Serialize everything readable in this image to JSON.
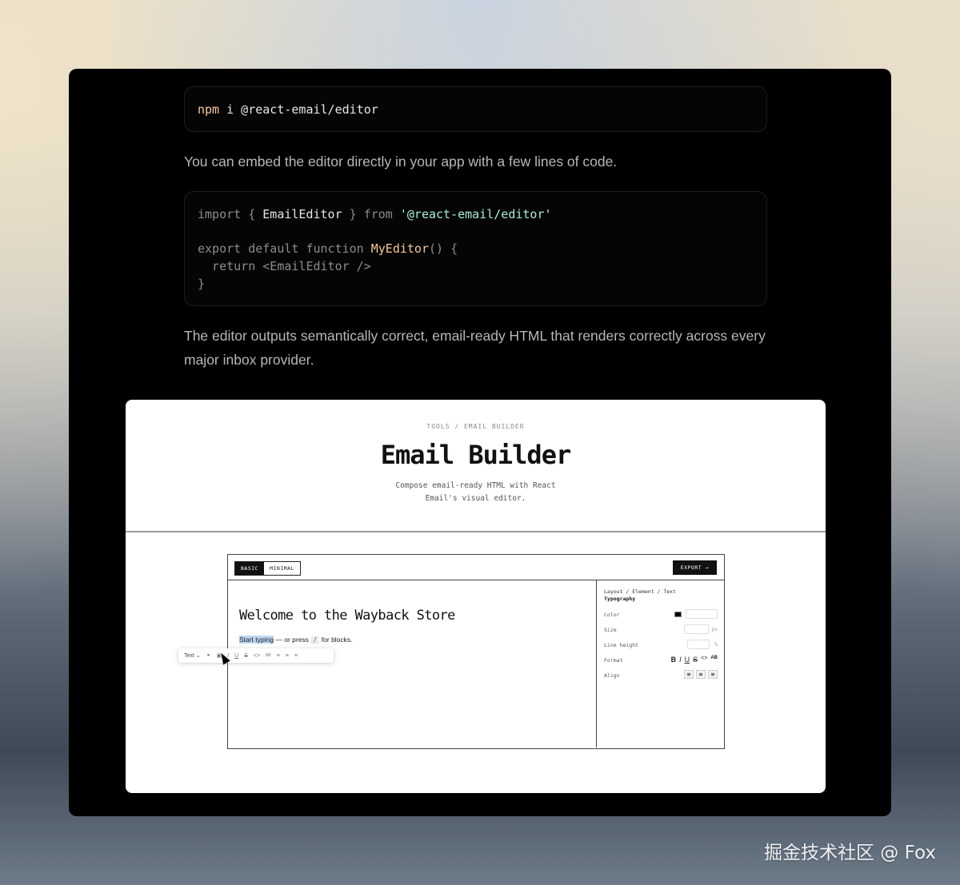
{
  "install_cmd": {
    "cmd": "npm",
    "rest": " i @react-email/editor"
  },
  "intro_text": "You can embed the editor directly in your app with a few lines of code.",
  "code": {
    "l1_import": "import",
    "l1_open": " { ",
    "l1_name": "EmailEditor",
    "l1_close": " } ",
    "l1_from": "from",
    "l1_sp": " ",
    "l1_str": "'@react-email/editor'",
    "l3_kw": "export default function ",
    "l3_fn": "MyEditor",
    "l3_tail": "() {",
    "l4": "  return <EmailEditor />",
    "l5": "}"
  },
  "outro_text": "The editor outputs semantically correct, email-ready HTML that renders correctly across every major inbox provider.",
  "shot": {
    "crumb": "TOOLS / EMAIL BUILDER",
    "title": "Email Builder",
    "subtitle_1": "Compose email-ready HTML with React",
    "subtitle_2": "Email's visual editor.",
    "tab_basic": "BASIC",
    "tab_minimal": "MINIMAL",
    "export": "EXPORT →",
    "heading": "Welcome to the Wayback Store",
    "typing_hl": "Start typing",
    "typing_mid": " — or press ",
    "typing_key": "/",
    "typing_end": " for blocks.",
    "toolbar_text": "Text ⌄",
    "panel": {
      "crumb": "Layout / Element / Text",
      "head": "Typography",
      "color": "Color",
      "size": "Size",
      "size_unit": "px",
      "line_height": "Line height",
      "lh_unit": "%",
      "format": "Format",
      "align": "Align"
    }
  },
  "watermark": "掘金技术社区 @ Fox"
}
